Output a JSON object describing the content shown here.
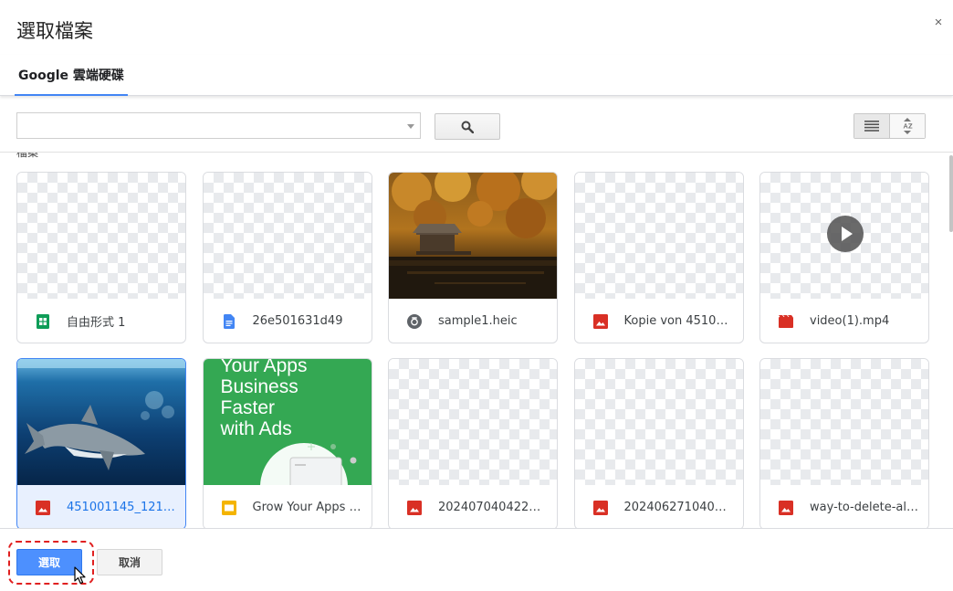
{
  "dialog": {
    "title": "選取檔案",
    "close_label": "×"
  },
  "tabs": [
    {
      "label": "Google 雲端硬碟",
      "active": true
    }
  ],
  "search": {
    "value": "",
    "placeholder": ""
  },
  "section": {
    "label": "檔案"
  },
  "files": [
    {
      "name": "自由形式 1",
      "type": "sheets",
      "icon": "sheets-icon",
      "thumb": "blank"
    },
    {
      "name": "26e501631d49",
      "type": "docs",
      "icon": "docs-icon",
      "thumb": "blank"
    },
    {
      "name": "sample1.heic",
      "type": "heic",
      "icon": "camera-icon",
      "thumb": "autumn-lake-cabin"
    },
    {
      "name": "Kopie von 451001…",
      "type": "image",
      "icon": "image-icon",
      "thumb": "blank"
    },
    {
      "name": "video(1).mp4",
      "type": "video",
      "icon": "video-icon",
      "thumb": "video"
    },
    {
      "name": "451001145_1214…",
      "type": "image",
      "icon": "image-icon",
      "thumb": "shark",
      "selected": true
    },
    {
      "name": "Grow Your Apps B…",
      "type": "slides",
      "icon": "slides-icon",
      "thumb": "promo"
    },
    {
      "name": "20240704042209…",
      "type": "image",
      "icon": "image-icon",
      "thumb": "blank"
    },
    {
      "name": "20240627104038…",
      "type": "image",
      "icon": "image-icon",
      "thumb": "blank"
    },
    {
      "name": "way-to-delete-all-p…",
      "type": "image",
      "icon": "image-icon",
      "thumb": "blank"
    }
  ],
  "promo_thumb": {
    "lines": [
      "Your Apps",
      "Business",
      "Faster",
      "with Ads"
    ]
  },
  "buttons": {
    "select_label": "選取",
    "cancel_label": "取消"
  },
  "colors": {
    "accent": "#4285f4",
    "primary_button": "#4d90fe",
    "selected_card_bg": "#e8f0fe",
    "highlight_ring": "#e02020",
    "sheets_green": "#0f9d58",
    "docs_blue": "#4285f4",
    "image_red": "#d93025",
    "slides_yellow": "#f4b400",
    "promo_green": "#34a853"
  }
}
